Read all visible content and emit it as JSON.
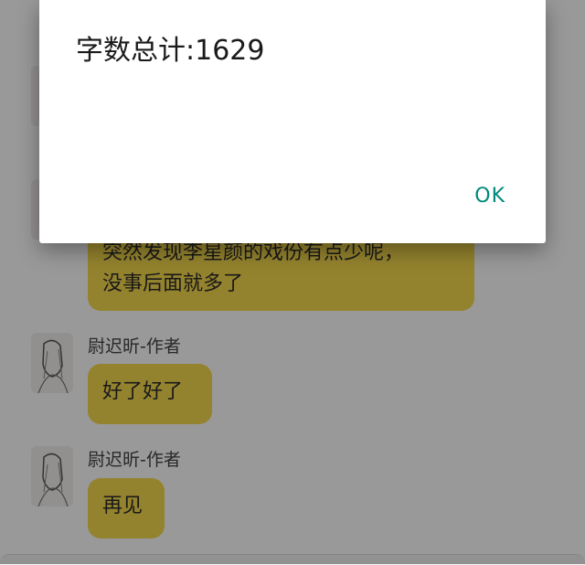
{
  "dialog": {
    "title": "字数总计:1629",
    "ok_label": "OK"
  },
  "messages": [
    {
      "sender": "",
      "text_lines": [
        "突然发现李星颜的戏份有点少呢，",
        "没事后面就多了"
      ]
    },
    {
      "sender": "尉迟昕-作者",
      "text_lines": [
        "好了好了"
      ]
    },
    {
      "sender": "尉迟昕-作者",
      "text_lines": [
        "再见"
      ]
    }
  ],
  "colors": {
    "bubble": "#f7da4e",
    "accent": "#00897b",
    "scrim": "rgba(0,0,0,0.40)"
  }
}
